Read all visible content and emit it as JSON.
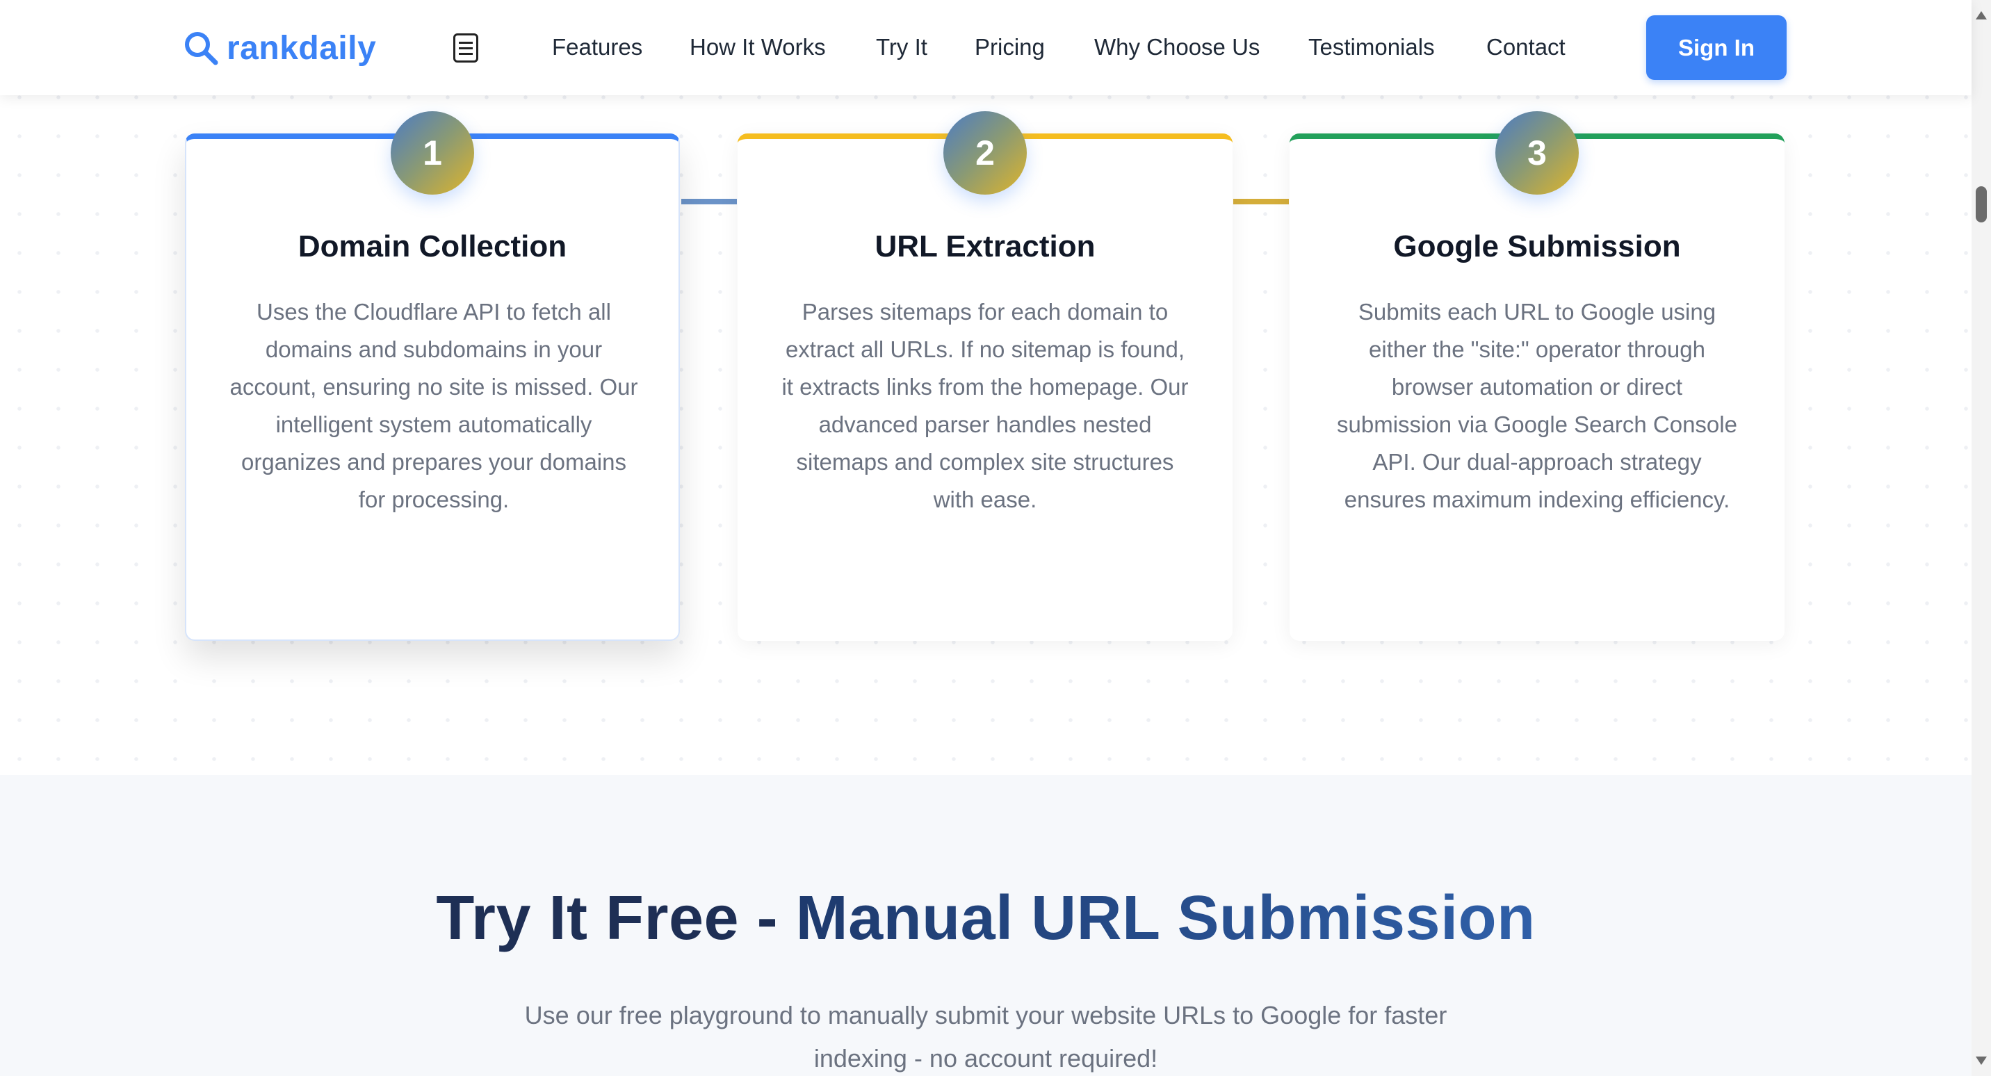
{
  "header": {
    "logo_text": "rankdaily",
    "nav": [
      {
        "label": "Features",
        "name": "nav-features"
      },
      {
        "label": "How It Works",
        "name": "nav-how-it-works"
      },
      {
        "label": "Try It",
        "name": "nav-try-it"
      },
      {
        "label": "Pricing",
        "name": "nav-pricing"
      },
      {
        "label": "Why Choose Us",
        "name": "nav-why-choose-us"
      },
      {
        "label": "Testimonials",
        "name": "nav-testimonials"
      },
      {
        "label": "Contact",
        "name": "nav-contact"
      }
    ],
    "signin_label": "Sign In"
  },
  "steps": [
    {
      "number": "1",
      "title": "Domain Collection",
      "description": "Uses the Cloudflare API to fetch all domains and subdomains in your account, ensuring no site is missed. Our intelligent system automatically organizes and prepares your domains for processing.",
      "accent": "#3b82f6"
    },
    {
      "number": "2",
      "title": "URL Extraction",
      "description": "Parses sitemaps for each domain to extract all URLs. If no sitemap is found, it extracts links from the homepage. Our advanced parser handles nested sitemaps and complex site structures with ease.",
      "accent": "#f5bd1f"
    },
    {
      "number": "3",
      "title": "Google Submission",
      "description": "Submits each URL to Google using either the \"site:\" operator through browser automation or direct submission via Google Search Console API. Our dual-approach strategy ensures maximum indexing efficiency.",
      "accent": "#22a05a"
    }
  ],
  "try_section": {
    "title_part1": "Try It Free - ",
    "title_part2": "Manual URL Submission",
    "subtitle": "Use our free playground to manually submit your website URLs to Google for faster indexing - no account required!"
  },
  "colors": {
    "brand": "#3b82f6",
    "connector_1": "#6b93c8",
    "connector_2": "#d4ad3a"
  },
  "icons": {
    "logo": "search-icon",
    "menu": "menu-icon"
  }
}
